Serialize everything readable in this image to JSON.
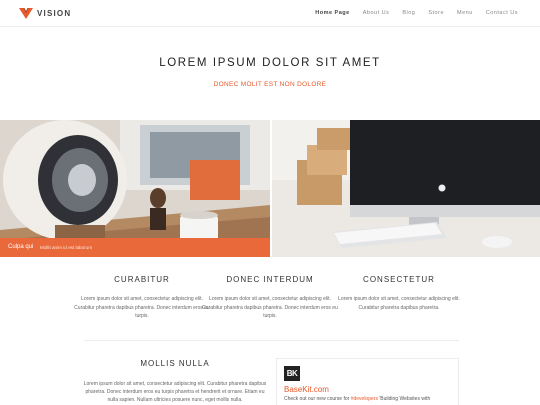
{
  "brand": {
    "name": "VISION",
    "accent": "#e8582a"
  },
  "nav": {
    "items": [
      {
        "label": "Home Page",
        "active": true
      },
      {
        "label": "About Us"
      },
      {
        "label": "Blog"
      },
      {
        "label": "Store"
      },
      {
        "label": "Menu"
      },
      {
        "label": "Contact Us"
      }
    ]
  },
  "hero": {
    "title": "LOREM IPSUM DOLOR SIT AMET",
    "subtitle": "DONEC MOLIT EST NON DOLORE"
  },
  "gallery": {
    "left_caption_title": "Culpa qui",
    "left_caption_text": "Mollit anim id est laborum"
  },
  "columns": [
    {
      "title": "CURABITUR",
      "text": "Lorem ipsum dolor sit amet, consectetur adipiscing elit. Curabitur pharetra dapibus pharetra. Donec interdum eros eu turpis."
    },
    {
      "title": "DONEC INTERDUM",
      "text": "Lorem ipsum dolor sit amet, consectetur adipiscing elit. Curabitur pharetra dapibus pharetra. Donec interdum eros eu turpis."
    },
    {
      "title": "CONSECTETUR",
      "text": "Lorem ipsum dolor sit amet, consectetur adipiscing elit. Curabitur pharetra dapibus pharetra."
    }
  ],
  "mollis": {
    "title": "MOLLIS NULLA",
    "text": "Lorem ipsum dolor sit amet, consectetur adipiscing elit. Curabitur pharetra dapibus pharetra. Donec interdum eros eu turpis pharetra et hendrerit et ornare. Etiam eu nulla sapien. Nullam ultricies posuere nunc, eget mollis nulla."
  },
  "basekit": {
    "badge": "BK",
    "name": "BaseKit.com",
    "text_before": "Check out our new course for ",
    "link": "#developers",
    "text_after": " 'Building Websites with"
  }
}
